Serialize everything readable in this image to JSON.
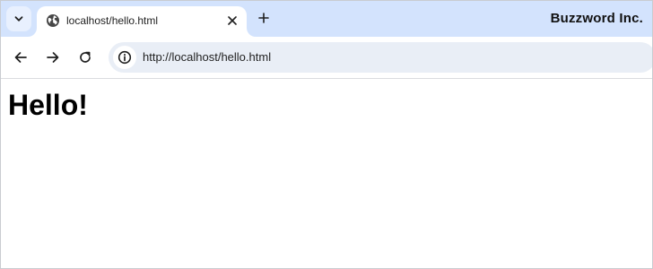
{
  "browser": {
    "tab": {
      "title": "localhost/hello.html",
      "favicon": "globe-icon"
    },
    "profile_label": "Buzzword Inc.",
    "address_bar": {
      "url": "http://localhost/hello.html",
      "site_info_icon": "info-icon"
    },
    "icons": {
      "tab_search": "chevron-down-icon",
      "tab_close": "close-icon",
      "new_tab": "plus-icon",
      "back": "arrow-left-icon",
      "forward": "arrow-right-icon",
      "reload": "reload-icon"
    },
    "colors": {
      "tabstrip": "#d3e3fd",
      "omnibox": "#e9eef6",
      "text": "#1f1f1f"
    }
  },
  "page": {
    "heading": "Hello!"
  }
}
